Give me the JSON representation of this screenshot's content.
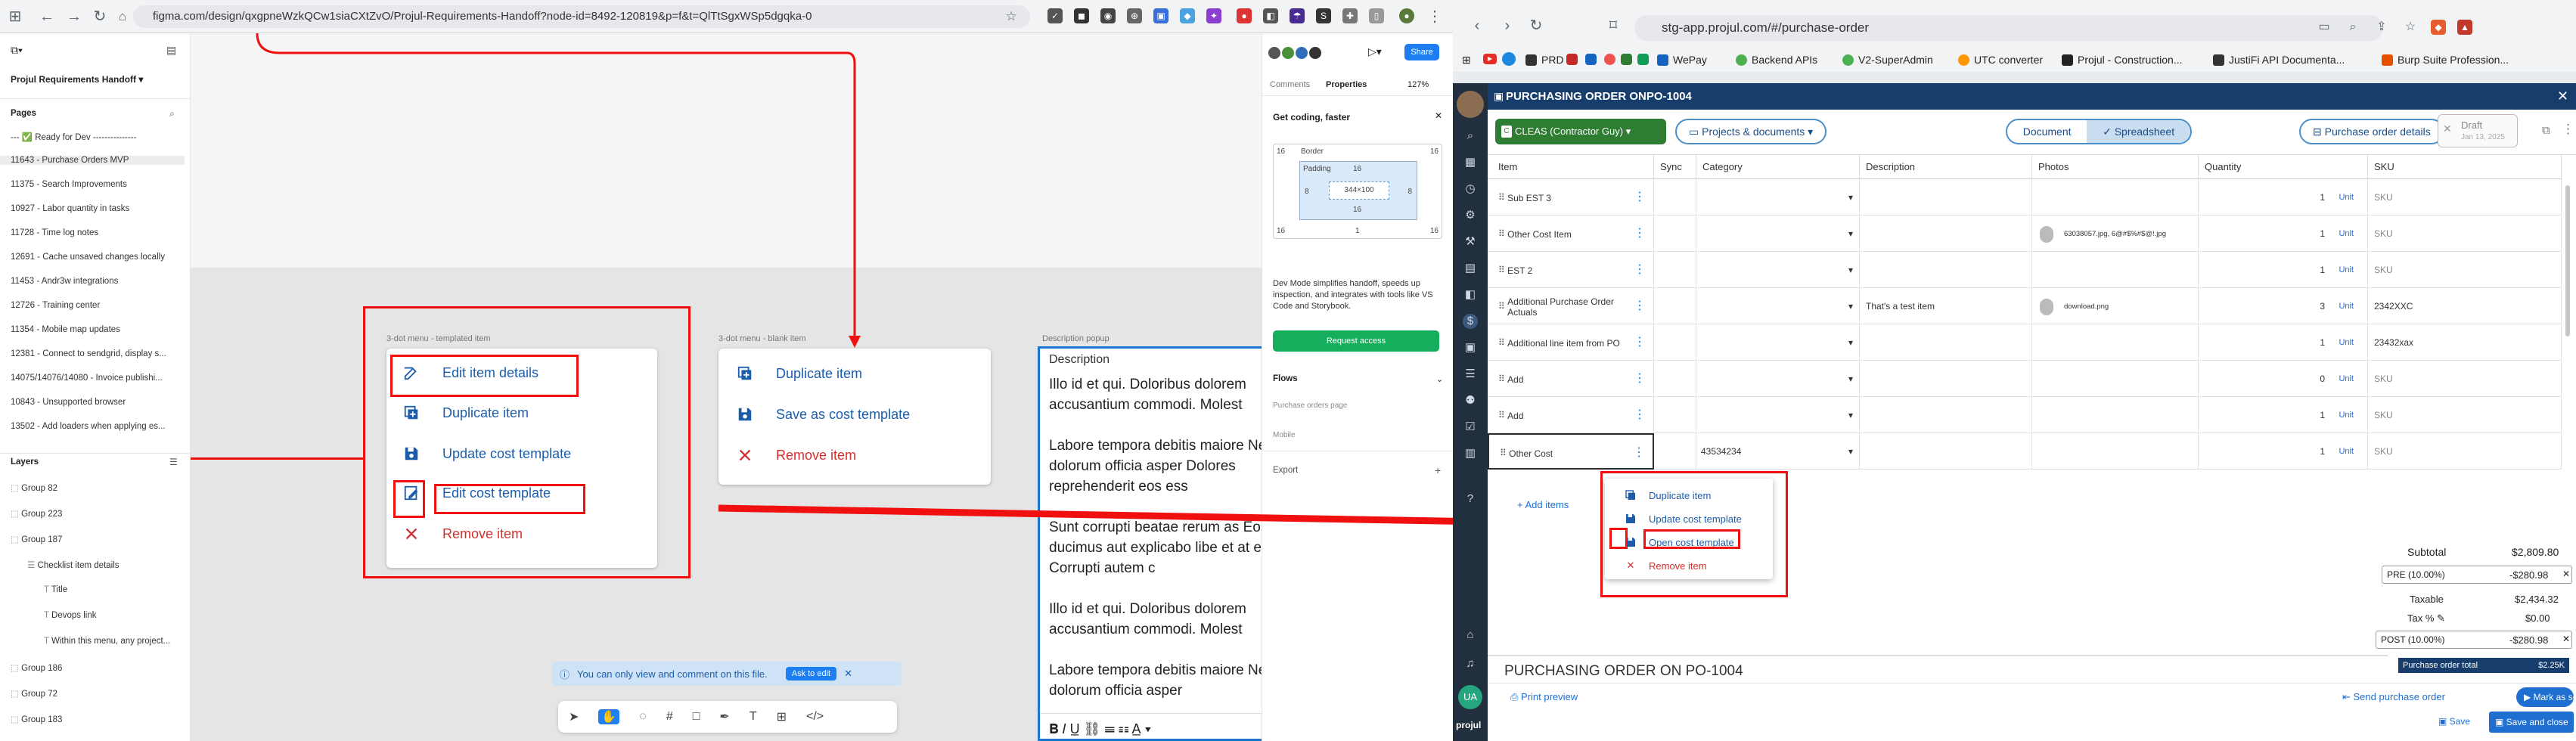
{
  "left_window": {
    "url": "figma.com/design/qxgpneWzkQCw1siaCXtZvO/Projul-Requirements-Handoff?node-id=8492-120819&p=f&t=QlTtSgxWSp5dgqka-0",
    "project_name": "Projul Requirements Handoff",
    "pages_label": "Pages",
    "pages": [
      "--- ✅ Ready for Dev ---------------",
      "11643 - Purchase Orders MVP",
      "11375 - Search Improvements",
      "10927 - Labor quantity in tasks",
      "11728 - Time log notes",
      "12691 - Cache unsaved changes locally",
      "11453 - Andr3w integrations",
      "12726 - Training center",
      "11354 - Mobile map updates",
      "12381 - Connect to sendgrid, display s...",
      "14075/14076/14080 - Invoice publishi...",
      "10843 - Unsupported browser",
      "13502 - Add loaders when applying es..."
    ],
    "layers_label": "Layers",
    "layers": [
      "Group 82",
      "Group 223",
      "Group 187",
      "Checklist item details",
      "Title",
      "Devops link",
      "Within this menu, any project...",
      "Group 186",
      "Group 72",
      "Group 183"
    ],
    "frame_labels": {
      "templated": "3-dot menu - templated item",
      "blank": "3-dot menu - blank item",
      "description": "Description popup"
    },
    "templated_menu": [
      "Edit item details",
      "Duplicate item",
      "Update cost template",
      "Edit cost template",
      "Remove item"
    ],
    "blank_menu": [
      "Duplicate item",
      "Save as cost template",
      "Remove item"
    ],
    "description_popup": {
      "title": "Description",
      "paragraphs": [
        "Illo id et qui. Doloribus dolorem accusantium commodi. Molest",
        "Labore tempora debitis maiore Nesciunt dolorum officia asper Dolores reprehenderit eos ess",
        "Sunt corrupti beatae rerum as Eos ducimus aut explicabo libe et at et eum. Corrupti autem c",
        "Illo id et qui. Doloribus dolorem accusantium commodi. Molest",
        "Labore tempora debitis maiore Nesciunt dolorum officia asper"
      ]
    },
    "toast": {
      "text": "You can only view and comment on this file.",
      "button": "Ask to edit"
    },
    "right_panel": {
      "tabs": [
        "Comments",
        "Properties"
      ],
      "zoom": "127%",
      "share": "Share",
      "title": "Get coding, faster",
      "box_model": {
        "outer": "16",
        "border": "Border",
        "padding": "Padding",
        "padding_val": "16",
        "left": "8",
        "right": "8",
        "size": "344×100",
        "bottom": "16",
        "b_left": "16",
        "b_mid": "1",
        "b_right": "16"
      },
      "dev_text": "Dev Mode simplifies handoff, speeds up inspection, and integrates with tools like VS Code and Storybook.",
      "request_access": "Request access",
      "flows_label": "Flows",
      "flow_items": [
        "Purchase orders page",
        "Mobile"
      ],
      "export_label": "Export"
    }
  },
  "right_window": {
    "url": "stg-app.projul.com/#/purchase-order",
    "bookmarks": [
      "PRD",
      "WePay",
      "Backend APIs",
      "V2-SuperAdmin",
      "UTC converter",
      "Projul - Construction...",
      "JustiFi API Documenta...",
      "Burp Suite Profession..."
    ],
    "po_title": "PURCHASING ORDER ONPO-1004",
    "vendor": "CLEAS (Contractor Guy)",
    "projects": "Projects & documents",
    "view_document": "Document",
    "view_spreadsheet": "Spreadsheet",
    "po_details": "Purchase order details",
    "draft": "Draft",
    "draft_date": "Jan 13, 2025",
    "columns": [
      "Item",
      "Sync",
      "Category",
      "Description",
      "Photos",
      "Quantity",
      "SKU"
    ],
    "rows": [
      {
        "item": "Sub EST 3",
        "category": "",
        "description": "",
        "photos": "",
        "qty": "1",
        "unit": "Unit",
        "sku": "SKU"
      },
      {
        "item": "Other Cost Item",
        "category": "",
        "description": "",
        "photos": "63038057.jpg, 6@#$%#$@!.jpg",
        "qty": "1",
        "unit": "Unit",
        "sku": "SKU"
      },
      {
        "item": "EST 2",
        "category": "",
        "description": "",
        "photos": "",
        "qty": "1",
        "unit": "Unit",
        "sku": "SKU"
      },
      {
        "item": "Additional Purchase Order Actuals",
        "category": "",
        "description": "That's a test item",
        "photos": "download.png",
        "qty": "3",
        "unit": "Unit",
        "sku": "2342XXC"
      },
      {
        "item": "Additional line item from PO",
        "category": "",
        "description": "",
        "photos": "",
        "qty": "1",
        "unit": "Unit",
        "sku": "23432xax"
      },
      {
        "item": "Add",
        "category": "",
        "description": "",
        "photos": "",
        "qty": "0",
        "unit": "Unit",
        "sku": "SKU"
      },
      {
        "item": "Add",
        "category": "",
        "description": "",
        "photos": "",
        "qty": "1",
        "unit": "Unit",
        "sku": "SKU"
      },
      {
        "item": "Other Cost",
        "category": "43534234",
        "description": "",
        "photos": "",
        "qty": "1",
        "unit": "Unit",
        "sku": "SKU"
      }
    ],
    "add_items": "Add items",
    "context_menu": [
      "Duplicate item",
      "Update cost template",
      "Open cost template",
      "Remove item"
    ],
    "totals": {
      "subtotal_label": "Subtotal",
      "subtotal": "$2,809.80",
      "pre_label": "PRE (10.00%)",
      "pre": "-$280.98",
      "taxable_label": "Taxable",
      "taxable": "$2,434.32",
      "tax_label": "Tax %",
      "tax": "$0.00",
      "post_label": "POST (10.00%)",
      "post": "-$280.98",
      "po_total_label": "Purchase order total",
      "po_total": "$2.25K"
    },
    "footer_title": "PURCHASING ORDER ON  PO-1004",
    "print_preview": "Print preview",
    "send_po": "Send purchase order",
    "mark_sent": "Mark as sent",
    "save": "Save",
    "save_close": "Save and close",
    "avatar": "UA",
    "brand": "projul"
  },
  "colors": {
    "accent_blue": "#1c5dab",
    "red_annotation": "#f01010",
    "header_navy": "#163d6b",
    "sidebar_dark": "#222f3e"
  }
}
